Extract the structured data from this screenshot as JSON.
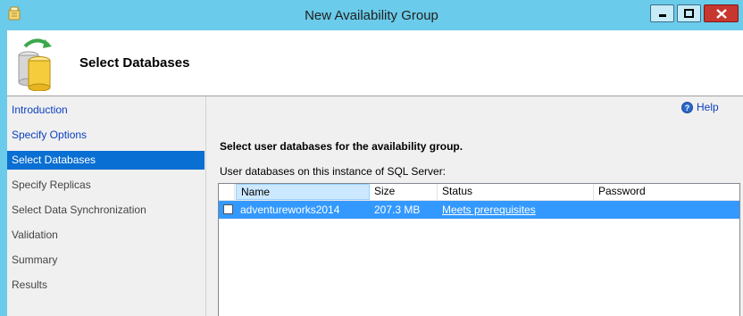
{
  "window": {
    "title": "New Availability Group"
  },
  "header": {
    "title": "Select Databases"
  },
  "nav": {
    "items": [
      {
        "label": "Introduction",
        "state": "done"
      },
      {
        "label": "Specify Options",
        "state": "done"
      },
      {
        "label": "Select Databases",
        "state": "active"
      },
      {
        "label": "Specify Replicas",
        "state": "pending"
      },
      {
        "label": "Select Data Synchronization",
        "state": "pending"
      },
      {
        "label": "Validation",
        "state": "pending"
      },
      {
        "label": "Summary",
        "state": "pending"
      },
      {
        "label": "Results",
        "state": "pending"
      }
    ]
  },
  "main": {
    "help_label": "Help",
    "instruction": "Select user databases for the availability group.",
    "grid_label": "User databases on this instance of SQL Server:",
    "columns": [
      "Name",
      "Size",
      "Status",
      "Password"
    ],
    "rows": [
      {
        "checked": false,
        "name": "adventureworks2014",
        "size": "207.3 MB",
        "status": "Meets prerequisites",
        "password": ""
      }
    ]
  },
  "colors": {
    "title_bar": "#6bcbea",
    "nav_selected": "#0a6fd2",
    "row_selected": "#3399ff",
    "link": "#0b3fbf",
    "close_button": "#c7372f"
  },
  "icons": [
    "app-icon",
    "minimize-icon",
    "maximize-icon",
    "close-icon",
    "database-sync-icon",
    "help-icon"
  ]
}
